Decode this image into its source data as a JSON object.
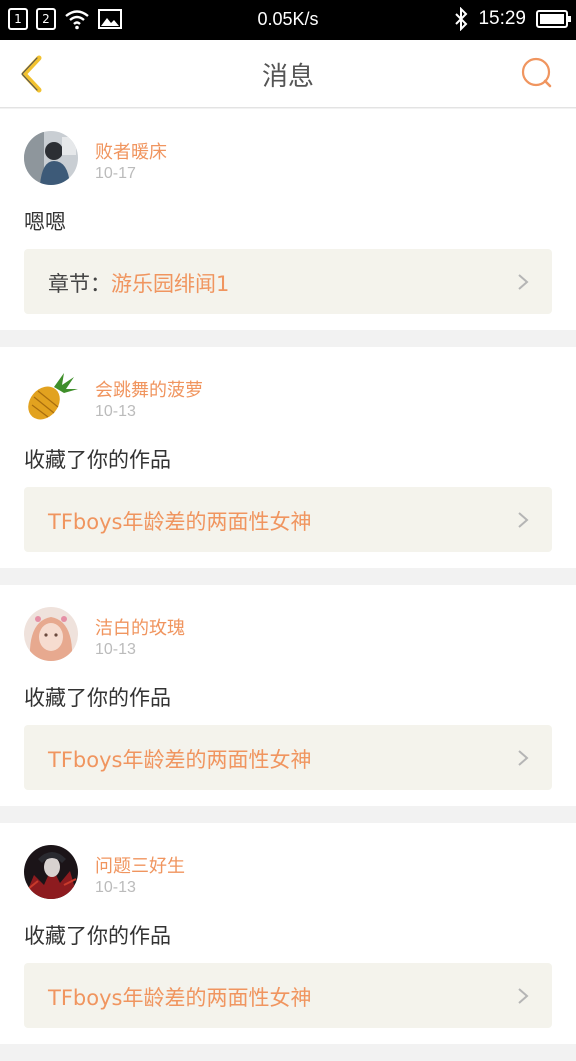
{
  "status_bar": {
    "sim1": "1",
    "sim2": "2",
    "speed": "0.05K/s",
    "time": "15:29"
  },
  "header": {
    "title": "消息"
  },
  "colors": {
    "accent": "#f0955f",
    "back_icon": "#f2c230"
  },
  "messages": [
    {
      "username": "败者暖床",
      "date": "10-17",
      "text": "嗯嗯",
      "chapter_prefix": "章节：",
      "chapter_name": "游乐园绯闻1"
    },
    {
      "username": "会跳舞的菠萝",
      "date": "10-13",
      "text": "收藏了你的作品",
      "chapter_prefix": "",
      "chapter_name": "TFboys年龄差的两面性女神"
    },
    {
      "username": "洁白的玫瑰",
      "date": "10-13",
      "text": "收藏了你的作品",
      "chapter_prefix": "",
      "chapter_name": "TFboys年龄差的两面性女神"
    },
    {
      "username": "问题三好生",
      "date": "10-13",
      "text": "收藏了你的作品",
      "chapter_prefix": "",
      "chapter_name": "TFboys年龄差的两面性女神"
    }
  ]
}
